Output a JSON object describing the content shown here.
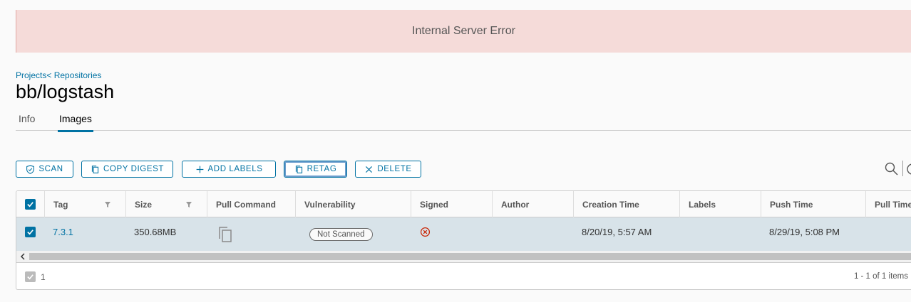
{
  "alert": {
    "message": "Internal Server Error"
  },
  "breadcrumb": {
    "projects": "Projects",
    "separator": "<",
    "repositories": " Repositories"
  },
  "page": {
    "title": "bb/logstash"
  },
  "tabs": [
    {
      "label": "Info"
    },
    {
      "label": "Images",
      "active": true
    }
  ],
  "toolbar": {
    "scan": "SCAN",
    "copy_digest": "COPY DIGEST",
    "add_labels": "ADD LABELS",
    "retag": "RETAG",
    "delete": "DELETE"
  },
  "table": {
    "columns": [
      "Tag",
      "Size",
      "Pull Command",
      "Vulnerability",
      "Signed",
      "Author",
      "Creation Time",
      "Labels",
      "Push Time",
      "Pull Time"
    ],
    "rows": [
      {
        "selected": true,
        "tag": "7.3.1",
        "size": "350.68MB",
        "vulnerability": "Not Scanned",
        "signed_icon": "x-circle-icon",
        "author": "",
        "creation_time": "8/20/19, 5:57 AM",
        "labels": "",
        "push_time": "8/29/19, 5:08 PM",
        "pull_time": ""
      }
    ],
    "footer": {
      "selected_count": "1",
      "pagination": "1 - 1 of 1 items"
    }
  },
  "colors": {
    "accent": "#0072a3",
    "alert_bg": "#f5dbd9",
    "row_selected": "#d8e3e9",
    "error_red": "#c92100"
  }
}
